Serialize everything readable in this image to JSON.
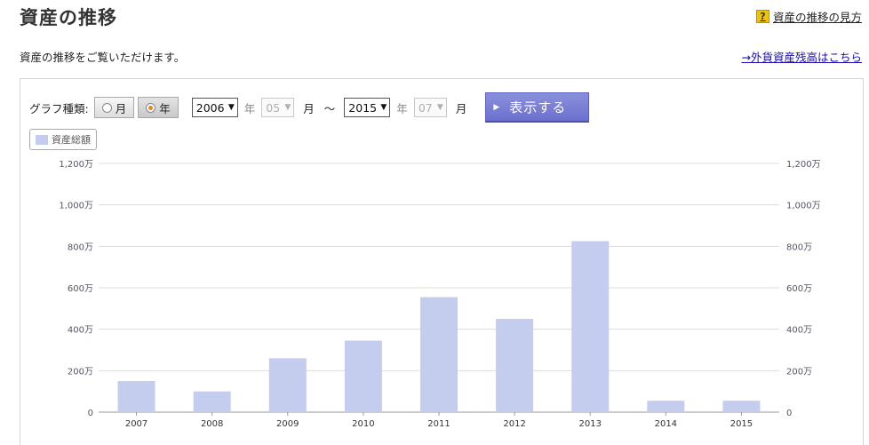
{
  "header": {
    "title": "資産の推移",
    "help_icon_glyph": "?",
    "help_link": "資産の推移の見方",
    "subtitle": "資産の推移をご覧いただけます。",
    "fx_link": "→外貨資産残高はこちら"
  },
  "controls": {
    "graph_type_label": "グラフ種類:",
    "radio_month": "月",
    "radio_year": "年",
    "selected_type": "年",
    "from_year": "2006",
    "from_month": "05",
    "to_year": "2015",
    "to_month": "07",
    "year_unit": "年",
    "month_unit": "月",
    "range_separator": "～",
    "show_button": "表示する"
  },
  "legend": {
    "label": "資産総額",
    "color": "#c5cdef"
  },
  "chart_data": {
    "type": "bar",
    "categories": [
      "2007",
      "2008",
      "2009",
      "2010",
      "2011",
      "2012",
      "2013",
      "2014",
      "2015"
    ],
    "series": [
      {
        "name": "資産総額",
        "values": [
          150,
          100,
          260,
          345,
          555,
          450,
          825,
          55,
          55
        ]
      }
    ],
    "ylim": [
      0,
      1200
    ],
    "yticks": [
      0,
      200,
      400,
      600,
      800,
      1000,
      1200
    ],
    "ytick_labels": [
      "0",
      "200万",
      "400万",
      "600万",
      "800万",
      "1,000万",
      "1,200万"
    ],
    "y_unit": "万",
    "grid": true,
    "dual_y_axis": true,
    "bar_color": "#c5cdef"
  }
}
